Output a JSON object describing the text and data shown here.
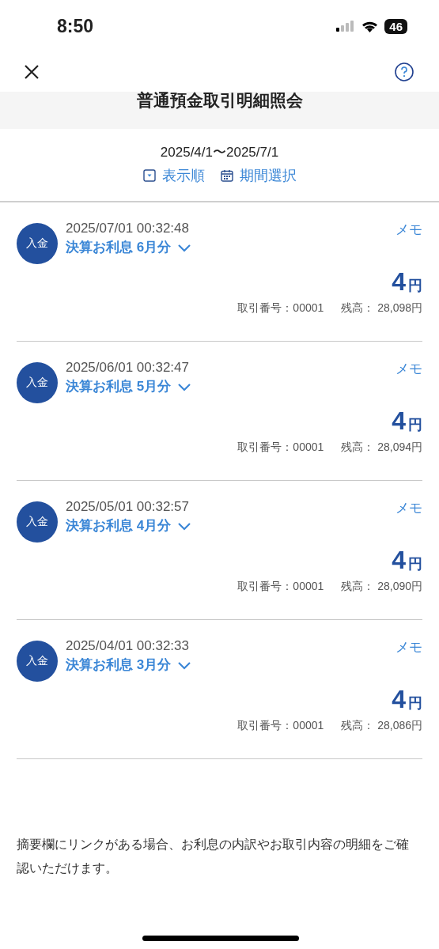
{
  "status_bar": {
    "time": "8:50",
    "battery": "46"
  },
  "header": {
    "title": "普通預金取引明細照会"
  },
  "period": {
    "range": "2025/4/1〜2025/7/1",
    "actions": [
      {
        "kind": "sort",
        "label": "表示順"
      },
      {
        "kind": "calendar",
        "label": "期間選択"
      }
    ]
  },
  "transactions": [
    {
      "type": "入金",
      "datetime": "2025/07/01 00:32:48",
      "description": "決算お利息 6月分",
      "expanded": false,
      "memo": "メモ",
      "amount": "4",
      "currency": "円",
      "number_label": "取引番号：",
      "number": "00001",
      "balance_label": "残高：",
      "balance": "28,098円"
    },
    {
      "type": "入金",
      "datetime": "2025/06/01 00:32:47",
      "description": "決算お利息 5月分",
      "expanded": false,
      "memo": "メモ",
      "amount": "4",
      "currency": "円",
      "number_label": "取引番号：",
      "number": "00001",
      "balance_label": "残高：",
      "balance": "28,094円"
    },
    {
      "type": "入金",
      "datetime": "2025/05/01 00:32:57",
      "description": "決算お利息 4月分",
      "expanded": false,
      "memo": "メモ",
      "amount": "4",
      "currency": "円",
      "number_label": "取引番号：",
      "number": "00001",
      "balance_label": "残高：",
      "balance": "28,090円"
    },
    {
      "type": "入金",
      "datetime": "2025/04/01 00:32:33",
      "description": "決算お利息 3月分",
      "expanded": false,
      "memo": "メモ",
      "amount": "4",
      "currency": "円",
      "number_label": "取引番号：",
      "number": "00001",
      "balance_label": "残高：",
      "balance": "28,086円"
    }
  ],
  "note": "摘要欄にリンクがある場合、お利息の内訳やお取引内容の明細をご確認いただけます。"
}
